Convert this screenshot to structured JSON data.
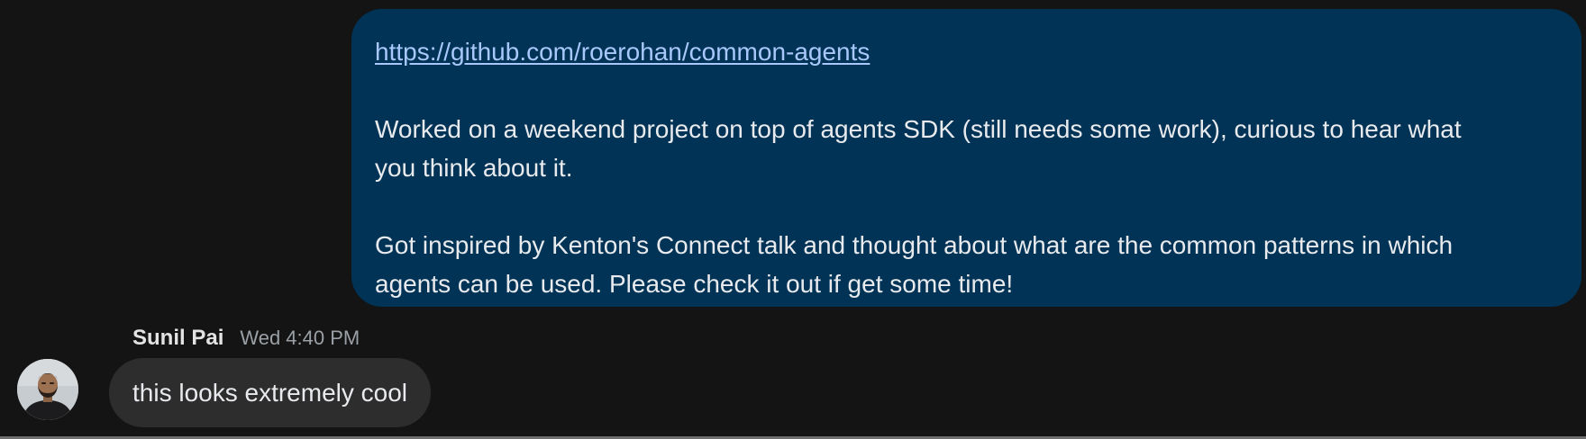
{
  "conversation": {
    "outgoing_message": {
      "link": "https://github.com/roerohan/common-agents",
      "paragraph_1_line_1": "Worked on a weekend project on top of agents SDK (still needs some work), curious to hear what",
      "paragraph_1_line_2": "you think about it.",
      "paragraph_2_line_1": "Got inspired by Kenton's Connect talk and thought about what are the common patterns in which",
      "paragraph_2_line_2": "agents can be used. Please check it out if get some time!"
    },
    "incoming_message": {
      "sender": "Sunil Pai",
      "timestamp": "Wed 4:40 PM",
      "text": "this looks extremely cool",
      "avatar_icon": "user-photo-avatar"
    }
  },
  "colors": {
    "background": "#141414",
    "outgoing_bubble": "#003355",
    "incoming_bubble": "#2d2d2e",
    "link": "#a8c7fa"
  }
}
